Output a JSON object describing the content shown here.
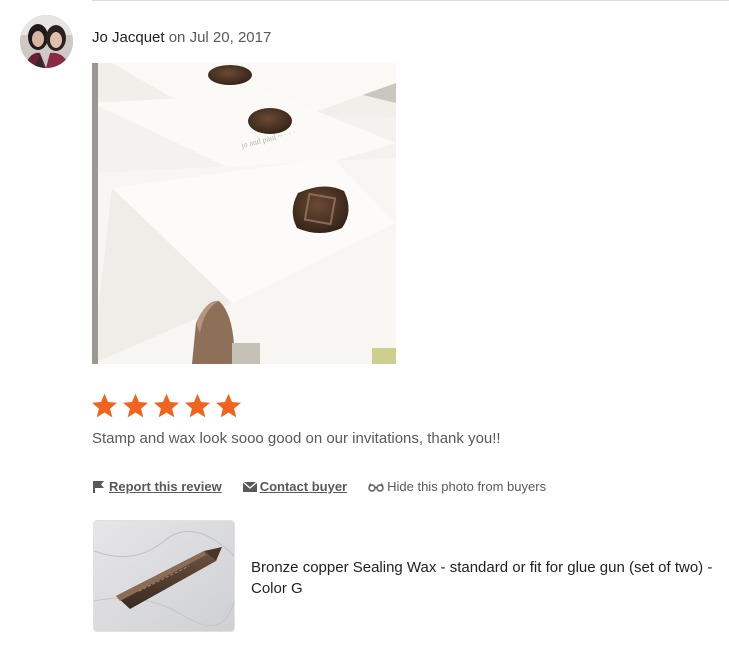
{
  "review": {
    "reviewer_name": "Jo Jacquet",
    "date_prefix": "on",
    "date": "Jul 20, 2017",
    "rating": 5,
    "rating_max": 5,
    "text": "Stamp and wax look sooo good on our invitations, thank you!!",
    "star_color": "#F1641E"
  },
  "actions": {
    "report_label": "Report this review",
    "contact_label": "Contact buyer",
    "hide_label": "Hide this photo from buyers",
    "report_icon": "flag-icon",
    "contact_icon": "envelope-icon",
    "hide_icon": "eyeglasses-icon"
  },
  "product": {
    "title": "Bronze copper Sealing Wax - standard or fit for glue gun (set of two) - Color G"
  }
}
